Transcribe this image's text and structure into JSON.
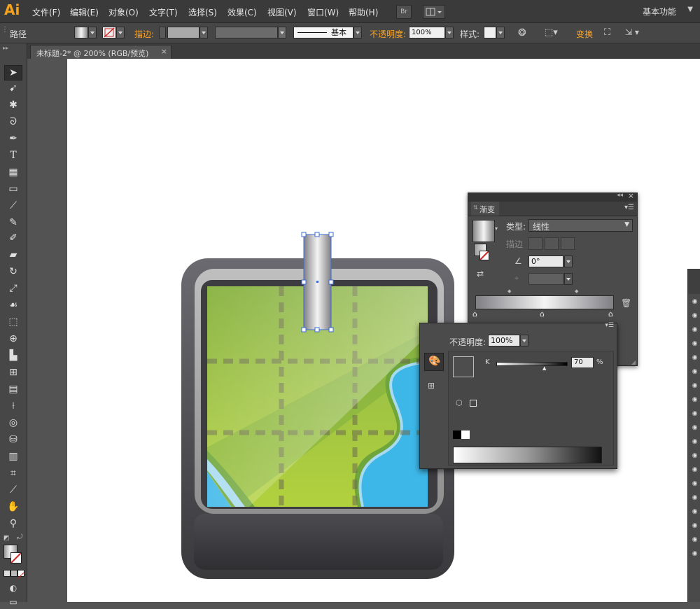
{
  "app": {
    "logo": "Ai"
  },
  "menu": {
    "items": [
      "文件(F)",
      "编辑(E)",
      "对象(O)",
      "文字(T)",
      "选择(S)",
      "效果(C)",
      "视图(V)",
      "窗口(W)",
      "帮助(H)"
    ],
    "bridge_label": "Br",
    "workspace": "基本功能"
  },
  "control_bar": {
    "selection_type": "路径",
    "stroke_label": "描边:",
    "stroke_style_label": "基本",
    "opacity_label": "不透明度:",
    "opacity_value": "100%",
    "style_label": "样式:",
    "transform_label": "变换"
  },
  "document": {
    "tab_title": "未标题-2* @ 200% (RGB/预览)",
    "close_glyph": "×"
  },
  "gradient_panel": {
    "title": "渐变",
    "type_label": "类型:",
    "type_value": "线性",
    "stroke_label": "描边",
    "angle_value": "0°",
    "trash_icon": "trash-icon"
  },
  "transparency_panel": {
    "opacity_label": "不透明度:",
    "opacity_value": "100%",
    "channel_label": "K",
    "channel_value": "70",
    "percent_sign": "%"
  },
  "colors": {
    "ui_dark": "#3a3a3a",
    "ui_mid": "#535353",
    "accent_orange": "#f5a32b",
    "selection_blue": "#3d6bd6",
    "map_green": "#9bc13f",
    "map_blue": "#3db7e8"
  }
}
